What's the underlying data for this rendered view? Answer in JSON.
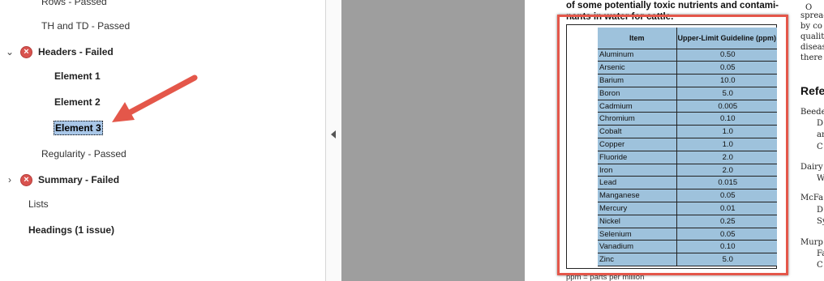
{
  "tree": {
    "items": [
      {
        "label": "Rows - Passed",
        "bold": false
      },
      {
        "label": "TH and TD - Passed",
        "bold": false
      },
      {
        "label": "Headers - Failed",
        "bold": true,
        "status": "failed",
        "expanded": true
      },
      {
        "label": "Element 1",
        "bold": true
      },
      {
        "label": "Element 2",
        "bold": true
      },
      {
        "label": "Element 3",
        "bold": true,
        "selected": true
      },
      {
        "label": "Regularity - Passed",
        "bold": false
      },
      {
        "label": "Summary - Failed",
        "bold": true,
        "status": "failed",
        "expanded": false
      },
      {
        "label": "Lists",
        "bold": false
      },
      {
        "label": "Headings (1 issue)",
        "bold": true
      }
    ],
    "chevron_expanded": "⌄",
    "chevron_collapsed": "›"
  },
  "document": {
    "caption_line1": "of some potentially toxic nutrients and contami-",
    "caption_line2": "nants in water for cattle.",
    "footnote": "ppm = parts per million",
    "right_col_lines": [
      "O",
      "spread",
      "by co",
      "qualit",
      "diseas",
      "there"
    ],
    "references_heading": "Refe",
    "references": [
      [
        "Beede",
        "D",
        "an",
        "C"
      ],
      [
        "Dairy",
        "W"
      ],
      [
        "McFa",
        "D",
        "Sy"
      ],
      [
        "Murp",
        "Fa",
        "C"
      ]
    ],
    "table": {
      "headers": [
        "Item",
        "Upper-Limit Guideline (ppm)"
      ],
      "rows": [
        [
          "Aluminum",
          "0.50"
        ],
        [
          "Arsenic",
          "0.05"
        ],
        [
          "Barium",
          "10.0"
        ],
        [
          "Boron",
          "5.0"
        ],
        [
          "Cadmium",
          "0.005"
        ],
        [
          "Chromium",
          "0.10"
        ],
        [
          "Cobalt",
          "1.0"
        ],
        [
          "Copper",
          "1.0"
        ],
        [
          "Fluoride",
          "2.0"
        ],
        [
          "Iron",
          "2.0"
        ],
        [
          "Lead",
          "0.015"
        ],
        [
          "Manganese",
          "0.05"
        ],
        [
          "Mercury",
          "0.01"
        ],
        [
          "Nickel",
          "0.25"
        ],
        [
          "Selenium",
          "0.05"
        ],
        [
          "Vanadium",
          "0.10"
        ],
        [
          "Zinc",
          "5.0"
        ]
      ]
    }
  },
  "colors": {
    "highlight": "#e4574a",
    "table_fill": "#9ec2dc",
    "canvas": "#9e9e9e",
    "fail_icon": "#d9534f",
    "arrow": "#e4574a"
  },
  "icons": {
    "fail": "fail-icon",
    "splitter": "collapse-left-icon",
    "annotation": "arrow-pointer-icon"
  }
}
